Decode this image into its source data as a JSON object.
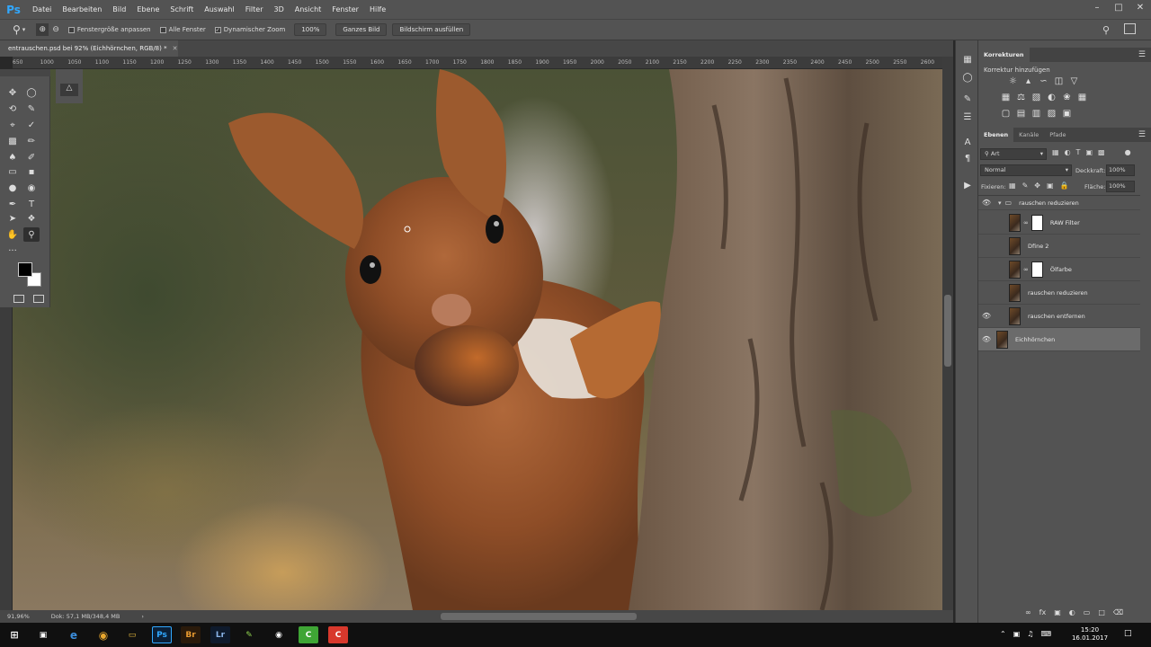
{
  "app": {
    "logo": "Ps"
  },
  "menu": [
    "Datei",
    "Bearbeiten",
    "Bild",
    "Ebene",
    "Schrift",
    "Auswahl",
    "Filter",
    "3D",
    "Ansicht",
    "Fenster",
    "Hilfe"
  ],
  "options": {
    "fit_window_label": "Fenstergröße anpassen",
    "all_windows_label": "Alle Fenster",
    "scrubby_zoom_label": "Dynamischer Zoom",
    "zoom_value": "100%",
    "fit_screen_label": "Ganzes Bild",
    "fill_screen_label": "Bildschirm ausfüllen"
  },
  "document": {
    "tab_title": "entrauschen.psd bei 92% (Eichhörnchen, RGB/8) *",
    "zoom_status": "91,96%",
    "doc_info": "Dok: 57,1 MB/348,4 MB"
  },
  "ruler": [
    "650",
    "1000",
    "1050",
    "1100",
    "1150",
    "1200",
    "1250",
    "1300",
    "1350",
    "1400",
    "1450",
    "1500",
    "1550",
    "1600",
    "1650",
    "1700",
    "1750",
    "1800",
    "1850",
    "1900",
    "1950",
    "2000",
    "2050",
    "2100",
    "2150",
    "2200",
    "2250",
    "2300",
    "2350",
    "2400",
    "2450",
    "2500",
    "2550",
    "2600"
  ],
  "adjustments": {
    "title": "Korrekturen",
    "add_label": "Korrektur hinzufügen"
  },
  "layers_panel": {
    "tabs": [
      "Ebenen",
      "Kanäle",
      "Pfade"
    ],
    "filter_kind": "Art",
    "blend_mode": "Normal",
    "opacity_label": "Deckkraft:",
    "opacity_value": "100%",
    "lock_label": "Fixieren:",
    "fill_label": "Fläche:",
    "fill_value": "100%",
    "layers": [
      {
        "name": "rauschen reduzieren",
        "type": "group",
        "visible": true
      },
      {
        "name": "RAW Filter",
        "type": "smart",
        "visible": false
      },
      {
        "name": "Dfine 2",
        "type": "filter",
        "visible": false
      },
      {
        "name": "Ölfarbe",
        "type": "smart",
        "visible": false
      },
      {
        "name": "rauschen reduzieren",
        "type": "layer",
        "visible": false
      },
      {
        "name": "rauschen entfernen",
        "type": "layer",
        "visible": true
      },
      {
        "name": "Eichhörnchen",
        "type": "layer",
        "visible": true,
        "selected": true
      }
    ]
  },
  "taskbar": {
    "time": "15:20",
    "date": "16.01.2017"
  },
  "colors": {
    "accent": "#31a8ff",
    "ui_bg": "#535353",
    "dark_bg": "#282828"
  }
}
